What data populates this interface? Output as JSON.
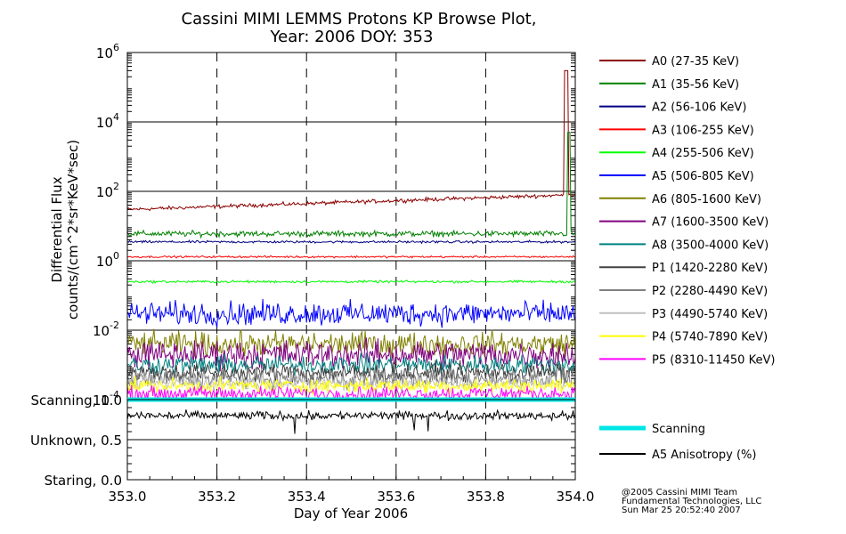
{
  "chart_data": {
    "type": "line",
    "title_line1": "Cassini MIMI LEMMS Protons KP Browse Plot,",
    "title_line2": "Year: 2006 DOY: 353",
    "xlabel": "Day of Year 2006",
    "ylabel_line1": "Differential Flux",
    "ylabel_line2": "counts/(cm^2*sr*KeV*sec)",
    "x_ticks": [
      "353.0",
      "353.2",
      "353.4",
      "353.6",
      "353.8",
      "354.0"
    ],
    "xlim": [
      353.0,
      354.0
    ],
    "y_scale": "log",
    "ylim": [
      0.0001,
      1000000
    ],
    "y_tick_labels": [
      {
        "base": "10",
        "exp": "6",
        "value": 1000000
      },
      {
        "base": "10",
        "exp": "4",
        "value": 10000
      },
      {
        "base": "10",
        "exp": "2",
        "value": 100
      },
      {
        "base": "10",
        "exp": "0",
        "value": 1
      },
      {
        "base": "10",
        "exp": "-2",
        "value": 0.01
      },
      {
        "base": "10",
        "exp": "-4",
        "value": 0.0001
      }
    ],
    "grid": true,
    "legend_position": "right",
    "series": [
      {
        "name": "A0 (27-35 KeV)",
        "color": "#8b0000",
        "level": 30,
        "level_end": 80,
        "jitter": 0.08,
        "spike_x": 353.98,
        "spike_value": 300000
      },
      {
        "name": "A1 (35-56 KeV)",
        "color": "#008000",
        "level": 6,
        "jitter": 0.12,
        "spike_x": 353.985,
        "spike_value": 5000
      },
      {
        "name": "A2 (56-106 KeV)",
        "color": "#000080",
        "level": 3.5,
        "jitter": 0.05
      },
      {
        "name": "A3 (106-255 KeV)",
        "color": "#ff0000",
        "level": 1.3,
        "jitter": 0.04
      },
      {
        "name": "A4 (255-506 KeV)",
        "color": "#00ff00",
        "level": 0.25,
        "jitter": 0.05
      },
      {
        "name": "A5 (506-805 KeV)",
        "color": "#0000ff",
        "level": 0.03,
        "jitter": 0.5
      },
      {
        "name": "A6 (805-1600 KeV)",
        "color": "#808000",
        "level": 0.004,
        "jitter": 0.5
      },
      {
        "name": "A7 (1600-3500 KeV)",
        "color": "#800080",
        "level": 0.002,
        "jitter": 0.6
      },
      {
        "name": "A8 (3500-4000 KeV)",
        "color": "#008080",
        "level": 0.001,
        "jitter": 0.4
      },
      {
        "name": "P1 (1420-2280 KeV)",
        "color": "#404040",
        "level": 0.0006,
        "jitter": 0.4
      },
      {
        "name": "P2 (2280-4490 KeV)",
        "color": "#808080",
        "level": 0.0004,
        "jitter": 0.4
      },
      {
        "name": "P3 (4490-5740 KeV)",
        "color": "#c0c0c0",
        "level": 0.0003,
        "jitter": 0.3
      },
      {
        "name": "P4 (5740-7890 KeV)",
        "color": "#ffff00",
        "level": 0.00025,
        "jitter": 0.3
      },
      {
        "name": "P5 (8310-11450 KeV)",
        "color": "#ff00ff",
        "level": 0.00015,
        "jitter": 0.3
      }
    ],
    "lower_panel": {
      "y_labels": [
        "Scanning, 1.0",
        "Unknown, 0.5",
        "Staring, 0.0"
      ],
      "y_values": [
        1.0,
        0.5,
        0.0
      ],
      "scanning": {
        "name": "Scanning",
        "color": "#00e5e5",
        "value": 1.0
      },
      "anisotropy": {
        "name": "A5 Anisotropy (%)",
        "color": "#000000",
        "level": 0.8,
        "jitter": 0.08
      }
    }
  },
  "credits": {
    "line1": "@2005 Cassini MIMI Team",
    "line2": "Fundamental Technologies, LLC",
    "line3": "Sun Mar 25 20:52:40 2007"
  }
}
